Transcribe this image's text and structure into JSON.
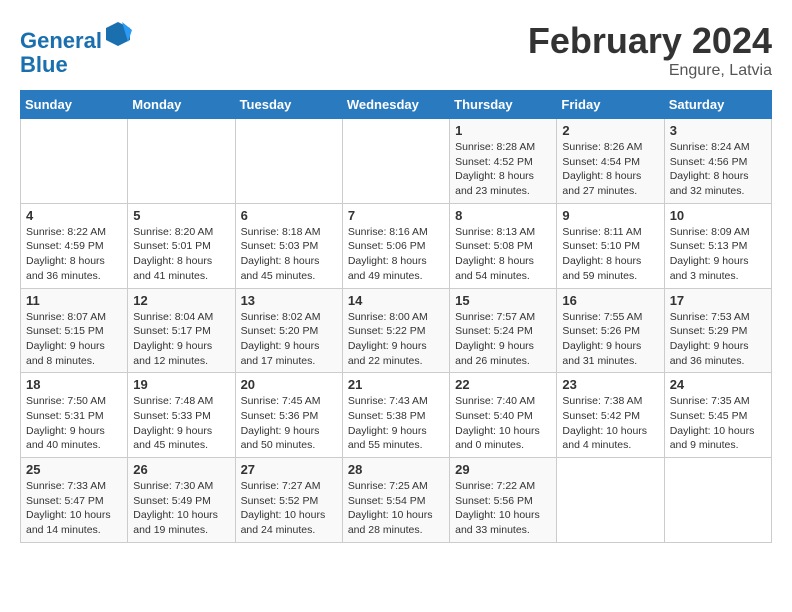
{
  "header": {
    "logo_line1": "General",
    "logo_line2": "Blue",
    "main_title": "February 2024",
    "sub_title": "Engure, Latvia"
  },
  "weekdays": [
    "Sunday",
    "Monday",
    "Tuesday",
    "Wednesday",
    "Thursday",
    "Friday",
    "Saturday"
  ],
  "weeks": [
    [
      {
        "day": "",
        "info": ""
      },
      {
        "day": "",
        "info": ""
      },
      {
        "day": "",
        "info": ""
      },
      {
        "day": "",
        "info": ""
      },
      {
        "day": "1",
        "info": "Sunrise: 8:28 AM\nSunset: 4:52 PM\nDaylight: 8 hours\nand 23 minutes."
      },
      {
        "day": "2",
        "info": "Sunrise: 8:26 AM\nSunset: 4:54 PM\nDaylight: 8 hours\nand 27 minutes."
      },
      {
        "day": "3",
        "info": "Sunrise: 8:24 AM\nSunset: 4:56 PM\nDaylight: 8 hours\nand 32 minutes."
      }
    ],
    [
      {
        "day": "4",
        "info": "Sunrise: 8:22 AM\nSunset: 4:59 PM\nDaylight: 8 hours\nand 36 minutes."
      },
      {
        "day": "5",
        "info": "Sunrise: 8:20 AM\nSunset: 5:01 PM\nDaylight: 8 hours\nand 41 minutes."
      },
      {
        "day": "6",
        "info": "Sunrise: 8:18 AM\nSunset: 5:03 PM\nDaylight: 8 hours\nand 45 minutes."
      },
      {
        "day": "7",
        "info": "Sunrise: 8:16 AM\nSunset: 5:06 PM\nDaylight: 8 hours\nand 49 minutes."
      },
      {
        "day": "8",
        "info": "Sunrise: 8:13 AM\nSunset: 5:08 PM\nDaylight: 8 hours\nand 54 minutes."
      },
      {
        "day": "9",
        "info": "Sunrise: 8:11 AM\nSunset: 5:10 PM\nDaylight: 8 hours\nand 59 minutes."
      },
      {
        "day": "10",
        "info": "Sunrise: 8:09 AM\nSunset: 5:13 PM\nDaylight: 9 hours\nand 3 minutes."
      }
    ],
    [
      {
        "day": "11",
        "info": "Sunrise: 8:07 AM\nSunset: 5:15 PM\nDaylight: 9 hours\nand 8 minutes."
      },
      {
        "day": "12",
        "info": "Sunrise: 8:04 AM\nSunset: 5:17 PM\nDaylight: 9 hours\nand 12 minutes."
      },
      {
        "day": "13",
        "info": "Sunrise: 8:02 AM\nSunset: 5:20 PM\nDaylight: 9 hours\nand 17 minutes."
      },
      {
        "day": "14",
        "info": "Sunrise: 8:00 AM\nSunset: 5:22 PM\nDaylight: 9 hours\nand 22 minutes."
      },
      {
        "day": "15",
        "info": "Sunrise: 7:57 AM\nSunset: 5:24 PM\nDaylight: 9 hours\nand 26 minutes."
      },
      {
        "day": "16",
        "info": "Sunrise: 7:55 AM\nSunset: 5:26 PM\nDaylight: 9 hours\nand 31 minutes."
      },
      {
        "day": "17",
        "info": "Sunrise: 7:53 AM\nSunset: 5:29 PM\nDaylight: 9 hours\nand 36 minutes."
      }
    ],
    [
      {
        "day": "18",
        "info": "Sunrise: 7:50 AM\nSunset: 5:31 PM\nDaylight: 9 hours\nand 40 minutes."
      },
      {
        "day": "19",
        "info": "Sunrise: 7:48 AM\nSunset: 5:33 PM\nDaylight: 9 hours\nand 45 minutes."
      },
      {
        "day": "20",
        "info": "Sunrise: 7:45 AM\nSunset: 5:36 PM\nDaylight: 9 hours\nand 50 minutes."
      },
      {
        "day": "21",
        "info": "Sunrise: 7:43 AM\nSunset: 5:38 PM\nDaylight: 9 hours\nand 55 minutes."
      },
      {
        "day": "22",
        "info": "Sunrise: 7:40 AM\nSunset: 5:40 PM\nDaylight: 10 hours\nand 0 minutes."
      },
      {
        "day": "23",
        "info": "Sunrise: 7:38 AM\nSunset: 5:42 PM\nDaylight: 10 hours\nand 4 minutes."
      },
      {
        "day": "24",
        "info": "Sunrise: 7:35 AM\nSunset: 5:45 PM\nDaylight: 10 hours\nand 9 minutes."
      }
    ],
    [
      {
        "day": "25",
        "info": "Sunrise: 7:33 AM\nSunset: 5:47 PM\nDaylight: 10 hours\nand 14 minutes."
      },
      {
        "day": "26",
        "info": "Sunrise: 7:30 AM\nSunset: 5:49 PM\nDaylight: 10 hours\nand 19 minutes."
      },
      {
        "day": "27",
        "info": "Sunrise: 7:27 AM\nSunset: 5:52 PM\nDaylight: 10 hours\nand 24 minutes."
      },
      {
        "day": "28",
        "info": "Sunrise: 7:25 AM\nSunset: 5:54 PM\nDaylight: 10 hours\nand 28 minutes."
      },
      {
        "day": "29",
        "info": "Sunrise: 7:22 AM\nSunset: 5:56 PM\nDaylight: 10 hours\nand 33 minutes."
      },
      {
        "day": "",
        "info": ""
      },
      {
        "day": "",
        "info": ""
      }
    ]
  ]
}
